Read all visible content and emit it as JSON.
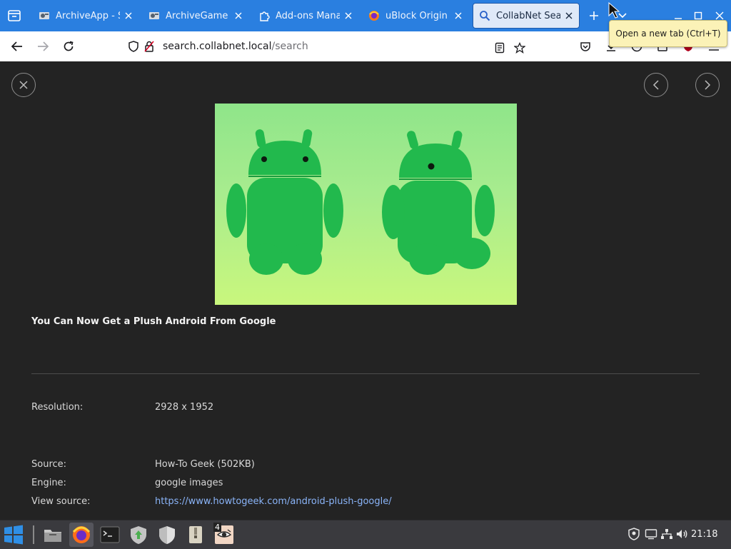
{
  "browser": {
    "tabs": [
      {
        "label": "ArchiveApp - Se",
        "icon": "archive-app-icon",
        "active": false
      },
      {
        "label": "ArchiveGame - I",
        "icon": "archive-game-icon",
        "active": false
      },
      {
        "label": "Add-ons Manag",
        "icon": "puzzle-icon",
        "active": false
      },
      {
        "label": "uBlock Origin –",
        "icon": "firefox-icon",
        "active": false
      },
      {
        "label": "CollabNet Sear",
        "icon": "search-icon",
        "active": true
      }
    ],
    "tooltip": "Open a new tab (Ctrl+T)",
    "url": {
      "host": "search.collabnet.local",
      "path": "/search"
    },
    "accent": "#2a7fe0"
  },
  "viewer": {
    "title": "You Can Now Get a Plush Android From Google",
    "details": [
      {
        "label": "Resolution:",
        "value": "2928 x 1952"
      },
      {
        "label": "Source:",
        "value": "How-To Geek (502KB)"
      },
      {
        "label": "Engine:",
        "value": "google images"
      },
      {
        "label": "View source:",
        "value": "https://www.howtogeek.com/android-plush-google/"
      }
    ],
    "link_color": "#8ab4f8"
  },
  "taskbar": {
    "badge": "4",
    "clock": "21:18"
  }
}
